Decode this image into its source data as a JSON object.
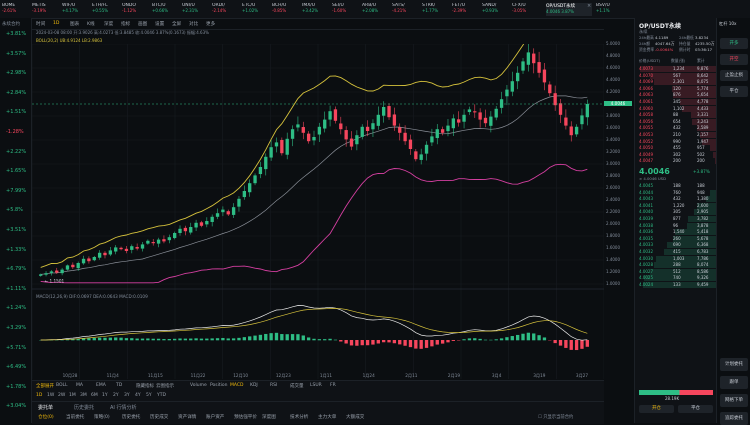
{
  "tabs": [
    {
      "name": "BOME",
      "pct": "-2.61%",
      "dir": "dn"
    },
    {
      "name": "METIS",
      "pct": "-3.19%",
      "dir": "dn"
    },
    {
      "name": "WIF/U",
      "pct": "+4.17%",
      "dir": "up"
    },
    {
      "name": "ETH/FL",
      "pct": "+0.55%",
      "dir": "up"
    },
    {
      "name": "ONDO",
      "pct": "-1.12%",
      "dir": "dn"
    },
    {
      "name": "BTC/U",
      "pct": "+0.66%",
      "dir": "up"
    },
    {
      "name": "UNI/U",
      "pct": "+2.31%",
      "dir": "up"
    },
    {
      "name": "ORDI/",
      "pct": "-2.14%",
      "dir": "dn"
    },
    {
      "name": "ETC/U",
      "pct": "+1.02%",
      "dir": "up"
    },
    {
      "name": "BCH/U",
      "pct": "-0.85%",
      "dir": "dn"
    },
    {
      "name": "IMX/U",
      "pct": "+3.42%",
      "dir": "up"
    },
    {
      "name": "SEI/U",
      "pct": "-1.60%",
      "dir": "dn"
    },
    {
      "name": "ARB/U",
      "pct": "+2.08%",
      "dir": "up"
    },
    {
      "name": "SATS/",
      "pct": "-4.21%",
      "dir": "dn"
    },
    {
      "name": "STRK/",
      "pct": "+1.77%",
      "dir": "up"
    },
    {
      "name": "FET/U",
      "pct": "-2.39%",
      "dir": "dn"
    },
    {
      "name": "SAND/",
      "pct": "+0.93%",
      "dir": "up"
    },
    {
      "name": "CFX/U",
      "pct": "-3.05%",
      "dir": "dn"
    }
  ],
  "active_tab": {
    "name": "OP/USDT永续",
    "pct": "4.0046 3.87%"
  },
  "trailing_tab": {
    "name": "BSV/U",
    "pct": "+1.1%"
  },
  "left_list": [
    {
      "v": "+3.81%",
      "d": "up"
    },
    {
      "v": "+3.57%",
      "d": "up"
    },
    {
      "v": "+2.98%",
      "d": "up"
    },
    {
      "v": "+2.84%",
      "d": "up"
    },
    {
      "v": "+1.51%",
      "d": "up"
    },
    {
      "v": "-1.28%",
      "d": "dn"
    },
    {
      "v": "+2.22%",
      "d": "up"
    },
    {
      "v": "+1.65%",
      "d": "up"
    },
    {
      "v": "+7.99%",
      "d": "up"
    },
    {
      "v": "+5.8%",
      "d": "up"
    },
    {
      "v": "+3.51%",
      "d": "up"
    },
    {
      "v": "+1.33%",
      "d": "up"
    },
    {
      "v": "+6.79%",
      "d": "up"
    },
    {
      "v": "+1.11%",
      "d": "up"
    },
    {
      "v": "+1.24%",
      "d": "up"
    },
    {
      "v": "+3.29%",
      "d": "up"
    },
    {
      "v": "+5.71%",
      "d": "up"
    },
    {
      "v": "+6.49%",
      "d": "up"
    },
    {
      "v": "+1.78%",
      "d": "up"
    },
    {
      "v": "+3.04%",
      "d": "up"
    }
  ],
  "left_header": "永续合约",
  "toolbar": [
    "时间",
    "1D",
    "图表",
    "K线",
    "深度",
    "指标",
    "画图",
    "设置",
    "全屏",
    "对比",
    "更多"
  ],
  "ohlc_line": "2024-03-08 08:00  开:3.9026  高:4.0273  低:3.8485  收:4.0046  3.87%(0.1673)  振幅:4.63%",
  "boll_line": "BOLL(20,2)  UB:4.9124  LB:2.9863",
  "macd_line": "MACD(12,26,9)  DIF:0.0697  DEA:0.0643  MACD:0.0109",
  "price_labels": {
    "high": "4.8629",
    "low": "1.1501",
    "last": "4.0046"
  },
  "y_axis": [
    "5.0000",
    "4.8000",
    "4.6000",
    "4.4000",
    "4.2000",
    "4.0000",
    "3.8000",
    "3.6000",
    "3.4000",
    "3.2000",
    "3.0000",
    "2.8000",
    "2.6000",
    "2.4000",
    "2.2000",
    "2.0000",
    "1.8000",
    "1.6000",
    "1.4000",
    "1.2000",
    "1.0000"
  ],
  "x_axis": [
    "10月28",
    "11月4",
    "11月15",
    "11月22",
    "12月10",
    "12月23",
    "1月11",
    "1月24",
    "2月11",
    "2月19",
    "3月4",
    "3月19",
    "3月27"
  ],
  "ctrl_row1": [
    "全部展开",
    "BOLL",
    "MA",
    "EMA",
    "TD",
    "隐藏指标",
    "云图指示"
  ],
  "ctrl_row1b": [
    "Volume",
    "Position",
    "MACD",
    "KDJ",
    "RSI",
    "成交量",
    "LSUR",
    "FR"
  ],
  "ctrl_row2": [
    "1D",
    "1W",
    "2W",
    "1M",
    "3M",
    "6M",
    "1Y",
    "2Y",
    "3Y",
    "4Y",
    "5Y",
    "YTD"
  ],
  "bottom_tabs": [
    "委托单",
    "历史委托",
    "AI 行情分析"
  ],
  "bottom_tabs2": [
    "仓位(0)",
    "当前委托",
    "策略(0)",
    "历史委托",
    "历史成交",
    "资产详情",
    "账户资产",
    "预估强平价",
    "深度图",
    "技术分析",
    "主力大单",
    "大额成交"
  ],
  "hide_other": "只显示当前合约",
  "ob": {
    "title": "OP/USDT永续",
    "sub": "永续",
    "stats": [
      [
        "24h最高",
        "4.1189"
      ],
      [
        "24h最低",
        "3.8234"
      ],
      [
        "24h额",
        "4047.64万"
      ],
      [
        "持仓量",
        "4235.50万"
      ],
      [
        "资金费率",
        "-0.0064%"
      ],
      [
        "倒计时",
        "03:36:17"
      ]
    ],
    "head": [
      "价格(USDT)",
      "数量(张)",
      "累计"
    ],
    "asks": [
      [
        "4.0073",
        "1,234",
        "9,876"
      ],
      [
        "4.0070",
        "567",
        "8,642"
      ],
      [
        "4.0069",
        "2,301",
        "8,075"
      ],
      [
        "4.0066",
        "120",
        "5,774"
      ],
      [
        "4.0063",
        "876",
        "5,654"
      ],
      [
        "4.0061",
        "345",
        "4,778"
      ],
      [
        "4.0060",
        "1,102",
        "4,433"
      ],
      [
        "4.0058",
        "88",
        "3,331"
      ],
      [
        "4.0056",
        "654",
        "3,243"
      ],
      [
        "4.0055",
        "432",
        "2,589"
      ],
      [
        "4.0053",
        "210",
        "2,157"
      ],
      [
        "4.0052",
        "990",
        "1,947"
      ],
      [
        "4.0050",
        "455",
        "957"
      ],
      [
        "4.0049",
        "302",
        "502"
      ],
      [
        "4.0047",
        "200",
        "200"
      ]
    ],
    "mid": "4.0046",
    "mid_sub": "≈ 4.0046 USD",
    "mid_pct": "+3.87%",
    "bids": [
      [
        "4.0045",
        "188",
        "188"
      ],
      [
        "4.0044",
        "760",
        "948"
      ],
      [
        "4.0043",
        "432",
        "1,380"
      ],
      [
        "4.0041",
        "1,220",
        "2,600"
      ],
      [
        "4.0040",
        "305",
        "2,905"
      ],
      [
        "4.0039",
        "877",
        "3,782"
      ],
      [
        "4.0038",
        "96",
        "3,878"
      ],
      [
        "4.0036",
        "1,540",
        "5,418"
      ],
      [
        "4.0035",
        "260",
        "5,678"
      ],
      [
        "4.0033",
        "690",
        "6,368"
      ],
      [
        "4.0032",
        "415",
        "6,783"
      ],
      [
        "4.0030",
        "1,003",
        "7,786"
      ],
      [
        "4.0028",
        "288",
        "8,074"
      ],
      [
        "4.0027",
        "512",
        "8,586"
      ],
      [
        "4.0025",
        "740",
        "9,326"
      ],
      [
        "4.0024",
        "133",
        "9,459"
      ]
    ],
    "ratio": "28.19K",
    "buy_tab": "开仓",
    "sell_tab": "平仓"
  },
  "side": {
    "top": "杠杆 10x",
    "items": [
      "开多",
      "开空",
      "止盈止损",
      "平仓"
    ],
    "btn1": "计划委托",
    "btn2": "跟单",
    "btn3": "网格下单",
    "btn4": "追踪委托"
  },
  "colors": {
    "up": "#2ebd85",
    "down": "#f6465d",
    "accent": "#f0b90b",
    "ub": "#d6c23c",
    "lb": "#d43fa0",
    "mid": "#c9ced6"
  },
  "chart_data": {
    "type": "candlestick",
    "closes": [
      1.16,
      1.18,
      1.21,
      1.19,
      1.24,
      1.31,
      1.28,
      1.35,
      1.42,
      1.38,
      1.45,
      1.52,
      1.48,
      1.56,
      1.61,
      1.58,
      1.55,
      1.63,
      1.59,
      1.66,
      1.72,
      1.68,
      1.74,
      1.71,
      1.78,
      1.85,
      1.92,
      1.88,
      1.95,
      2.02,
      1.97,
      2.05,
      2.12,
      2.18,
      2.24,
      2.16,
      2.28,
      2.42,
      2.55,
      2.68,
      2.81,
      2.95,
      3.12,
      3.28,
      3.36,
      3.18,
      3.42,
      3.58,
      3.66,
      3.52,
      3.38,
      3.45,
      3.62,
      3.74,
      3.88,
      3.72,
      3.58,
      3.41,
      3.29,
      3.48,
      3.62,
      3.55,
      3.68,
      3.82,
      3.95,
      3.78,
      3.64,
      3.52,
      3.38,
      3.25,
      3.08,
      3.16,
      3.32,
      3.46,
      3.58,
      3.52,
      3.64,
      3.76,
      3.69,
      3.82,
      3.91,
      3.86,
      3.74,
      3.68,
      3.79,
      3.92,
      4.08,
      4.24,
      4.38,
      4.52,
      4.71,
      4.86,
      4.68,
      4.52,
      4.36,
      4.18,
      3.98,
      3.82,
      3.64,
      3.48,
      3.62,
      3.81,
      4.0
    ]
  }
}
